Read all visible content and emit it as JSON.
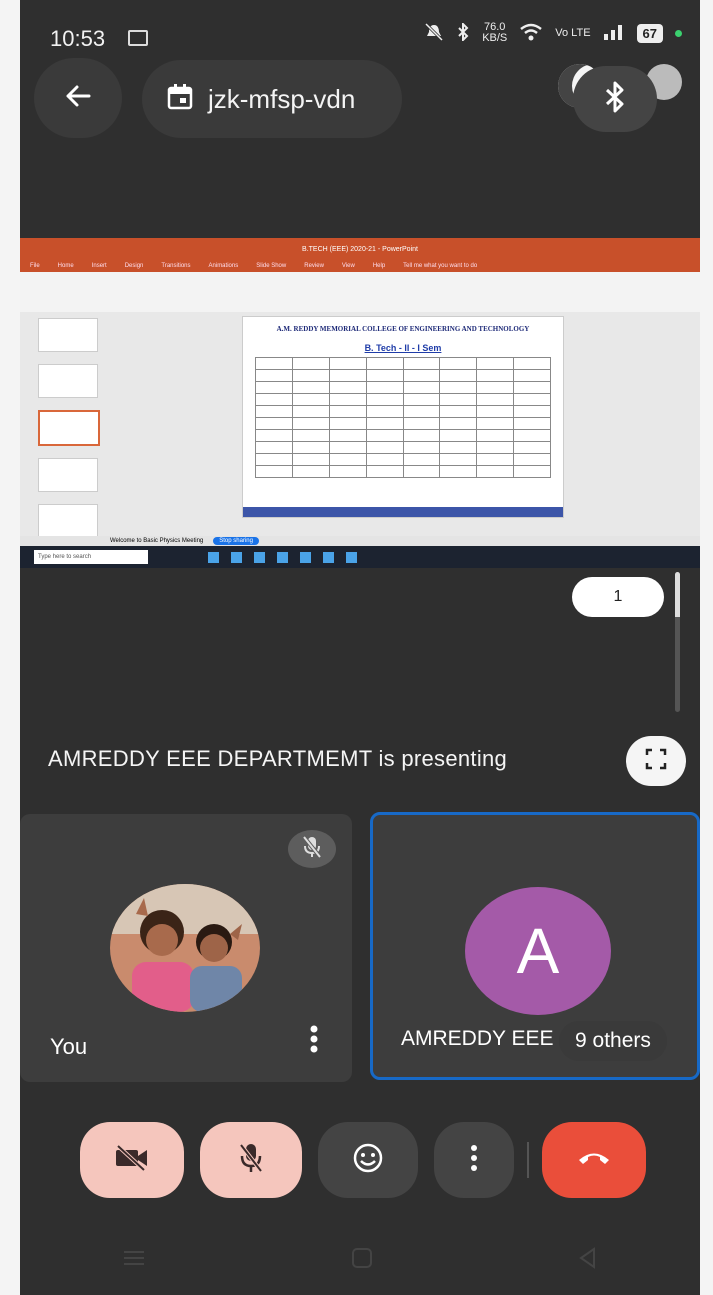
{
  "status_bar": {
    "time": "10:53",
    "net_speed_value": "76.0",
    "net_speed_unit": "KB/S",
    "volte": "Vo LTE",
    "battery": "67"
  },
  "header": {
    "meeting_code": "jzk-mfsp-vdn"
  },
  "shared_screen": {
    "window_title": "B.TECH (EEE) 2020-21 - PowerPoint",
    "menu": [
      "File",
      "Home",
      "Insert",
      "Design",
      "Transitions",
      "Animations",
      "Slide Show",
      "Review",
      "View",
      "Help",
      "Tell me what you want to do"
    ],
    "slide_title": "A.M. REDDY MEMORIAL COLLEGE OF ENGINEERING AND TECHNOLOGY",
    "slide_heading": "B. Tech - II - I Sem",
    "status_text": "Welcome to Basic Physics Meeting",
    "stop_sharing": "Stop sharing",
    "taskbar_search": "Type here to search"
  },
  "participant_count": "1",
  "presenting_text": "AMREDDY EEE DEPARTMEMT is presenting",
  "tiles": {
    "self_name": "You",
    "other_name": "AMREDDY EEE",
    "other_initial": "A",
    "others_label": "9 others"
  },
  "colors": {
    "background": "#2f2f2f",
    "accent_blue": "#1769c7",
    "avatar_purple": "#a45aa8",
    "end_call_red": "#ea4e3a",
    "muted_control": "#f5c6bd"
  },
  "icons": {
    "back": "arrow-left-icon",
    "calendar": "calendar-icon",
    "bluetooth": "bluetooth-icon",
    "fullscreen": "fullscreen-icon",
    "camera_off": "camera-off-icon",
    "mic_off": "mic-off-icon",
    "emoji": "emoji-icon",
    "more": "more-vertical-icon",
    "end_call": "end-call-icon"
  }
}
